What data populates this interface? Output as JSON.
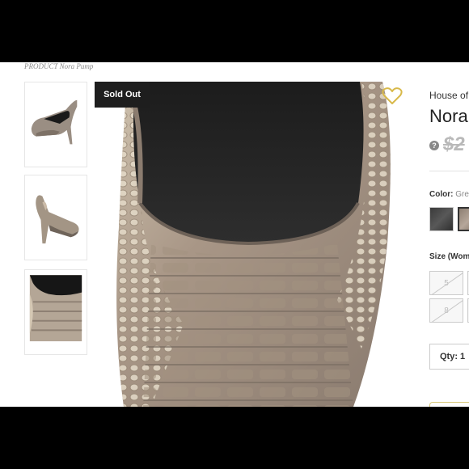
{
  "breadcrumb": "PRODUCT Nora Pump",
  "badge": "Sold Out",
  "brand": "House of",
  "product_name": "Nora",
  "price_help": "?",
  "price": "$2",
  "color": {
    "label": "Color:",
    "value": "Gre"
  },
  "size_label": "Size (Wom",
  "sizes": [
    "5",
    "",
    "8",
    ""
  ],
  "quantity": "Qty: 1",
  "icons": {
    "heart": "heart-outline-icon",
    "help": "question-circle-icon"
  },
  "colors": {
    "heart": "#d8b94a",
    "badge_bg": "#1e1e1e"
  }
}
